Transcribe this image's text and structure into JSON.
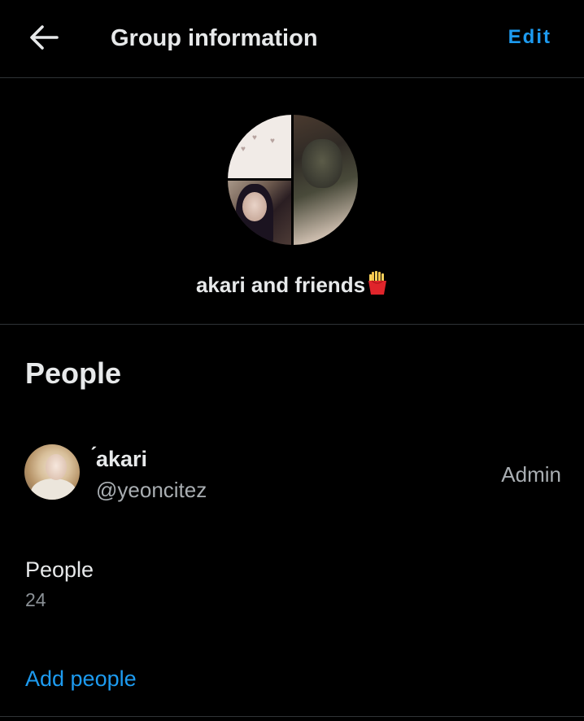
{
  "header": {
    "back_icon": "arrow-left-icon",
    "title": "Group information",
    "edit_label": "Edit"
  },
  "group": {
    "name": "akari and friends",
    "name_emoji": "french-fries-emoji"
  },
  "people_section": {
    "heading": "People",
    "members": [
      {
        "display_name": "́akari",
        "handle": "@yeoncitez",
        "role": "Admin"
      }
    ],
    "count_label": "People",
    "count_value": "24",
    "add_label": "Add people"
  },
  "colors": {
    "background": "#000000",
    "text_primary": "#e7e9ea",
    "text_secondary": "#a9aeb2",
    "accent": "#1d9bf0",
    "divider": "#2f3336"
  }
}
